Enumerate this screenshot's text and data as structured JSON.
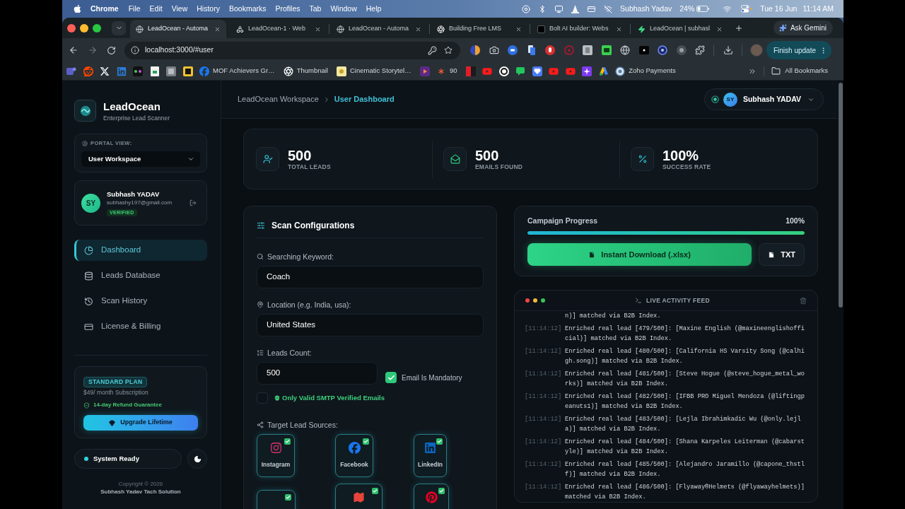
{
  "menu_bar": {
    "app": "Chrome",
    "menus": [
      "File",
      "Edit",
      "View",
      "History",
      "Bookmarks",
      "Profiles",
      "Tab",
      "Window",
      "Help"
    ],
    "user": "Subhash Yadav",
    "battery": "24%",
    "date": "Tue 16 Jun",
    "time": "11:14 AM"
  },
  "browser": {
    "tabs": [
      {
        "title": "LeadOcean - Automa",
        "selected": true
      },
      {
        "title": "LeadOcean-1 · Web",
        "selected": false
      },
      {
        "title": "LeadOcean - Automa",
        "selected": false
      },
      {
        "title": "Building Free LMS",
        "selected": false
      },
      {
        "title": "Bolt AI builder: Webs",
        "selected": false
      },
      {
        "title": "LeadOcean | subhasl",
        "selected": false
      }
    ],
    "gemini_button": "Ask Gemini",
    "url": "localhost:3000/#user",
    "update_button": "Finish update",
    "bookmarks": [
      {
        "label": "MOF Achievers Gr…"
      },
      {
        "label": "Thumbnail"
      },
      {
        "label": "Cinematic Storytel…"
      },
      {
        "label": "90"
      },
      {
        "label": "Zoho Payments"
      }
    ],
    "all_bookmarks": "All Bookmarks"
  },
  "sidebar": {
    "brand": "LeadOcean",
    "tagline": "Enterprise Lead Scanner",
    "portal_label": "PORTAL VIEW:",
    "portal_value": "User Workspace",
    "user": {
      "initials": "SY",
      "name": "Subhash YADAV",
      "email": "subhashy197@gmail.com",
      "badge": "VERIFIED"
    },
    "nav": [
      {
        "label": "Dashboard",
        "selected": true
      },
      {
        "label": "Leads Database",
        "selected": false
      },
      {
        "label": "Scan History",
        "selected": false
      },
      {
        "label": "License & Billing",
        "selected": false
      }
    ],
    "plan": {
      "badge": "STANDARD PLAN",
      "price": "$49/ month Subscription",
      "guarantee": "14-day Refund Guarantee",
      "button": "Upgrade Lifetime"
    },
    "status": "System Ready",
    "copyright": "Copyright © 2026",
    "company": "Subhash Yadav Tach Solution"
  },
  "header": {
    "breadcrumb": [
      "LeadOcean Workspace",
      "User Dashboard"
    ],
    "user": {
      "initials": "SY",
      "name": "Subhash YADAV"
    }
  },
  "stats": [
    {
      "value": "500",
      "label": "TOTAL LEADS"
    },
    {
      "value": "500",
      "label": "EMAILS FOUND"
    },
    {
      "value": "100%",
      "label": "SUCCESS RATE"
    }
  ],
  "scan_config": {
    "title": "Scan Configurations",
    "keyword": {
      "label": "Searching Keyword:",
      "value": "Coach"
    },
    "location": {
      "label": "Location (e.g. India, usa):",
      "value": "United States"
    },
    "leads_count": {
      "label": "Leads Count:",
      "value": "500"
    },
    "email_mandatory": {
      "label": "Email Is Mandatory",
      "checked": true
    },
    "smtp_only": {
      "label": "Only Valid SMTP Verified Emails",
      "checked": false
    },
    "sources_label": "Target Lead Sources:",
    "sources": [
      {
        "name": "Instagram",
        "checked": true
      },
      {
        "name": "Facebook",
        "checked": true
      },
      {
        "name": "LinkedIn",
        "checked": true
      },
      {
        "checked": true
      },
      {
        "checked": true
      },
      {
        "checked": true
      }
    ]
  },
  "progress": {
    "label": "Campaign Progress",
    "value": "100%",
    "level": 1,
    "download_button": "Instant Download (.xlsx)",
    "txt_button": "TXT"
  },
  "activity_feed": {
    "title": "LIVE ACTIVITY FEED",
    "entries": [
      {
        "text": "n)] matched via B2B Index."
      },
      {
        "time": "[11:14:12]",
        "text": "Enriched real lead [479/500]: [Maxine English (@maxineenglishofficial)] matched via B2B Index."
      },
      {
        "time": "[11:14:12]",
        "text": "Enriched real lead [480/500]: [California HS Varsity Song (@calhigh.song)] matched via B2B Index."
      },
      {
        "time": "[11:14:12]",
        "text": "Enriched real lead [481/500]: [Steve Hogue (@steve_hogue_metal_works)] matched via B2B Index."
      },
      {
        "time": "[11:14:12]",
        "text": "Enriched real lead [482/500]: [IFBB PRO Miguel Mendoza (@liftingpeanuts1)] matched via B2B Index."
      },
      {
        "time": "[11:14:12]",
        "text": "Enriched real lead [483/500]: [Lejla Ibrahimkadic Wu (@only.lejla)] matched via B2B Index."
      },
      {
        "time": "[11:14:12]",
        "text": "Enriched real lead [484/500]: [Shana Karpeles Leiterman (@cabarstyle)] matched via B2B Index."
      },
      {
        "time": "[11:14:12]",
        "text": "Enriched real lead [485/500]: [Alejandro Jaramillo (@capone_thstlf)] matched via B2B Index."
      },
      {
        "time": "[11:14:12]",
        "text": "Enriched real lead [486/500]: [Flyaway®Helmets (@flyawayhelmets)] matched via B2B Index."
      }
    ]
  }
}
